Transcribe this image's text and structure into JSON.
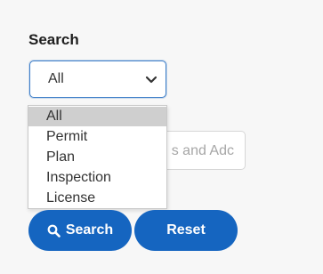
{
  "search": {
    "label": "Search",
    "selected_value": "All",
    "options": [
      "All",
      "Permit",
      "Plan",
      "Inspection",
      "License"
    ],
    "highlighted_option": "All"
  },
  "text_input": {
    "visible_placeholder": "s and Adc"
  },
  "buttons": {
    "search_label": "Search",
    "reset_label": "Reset"
  },
  "icons": {
    "search_button": "search-icon",
    "select_toggle": "chevron-down-icon"
  },
  "colors": {
    "primary": "#1565c0",
    "focus_border": "#3f7fc9",
    "highlight": "#cfcfcf"
  }
}
